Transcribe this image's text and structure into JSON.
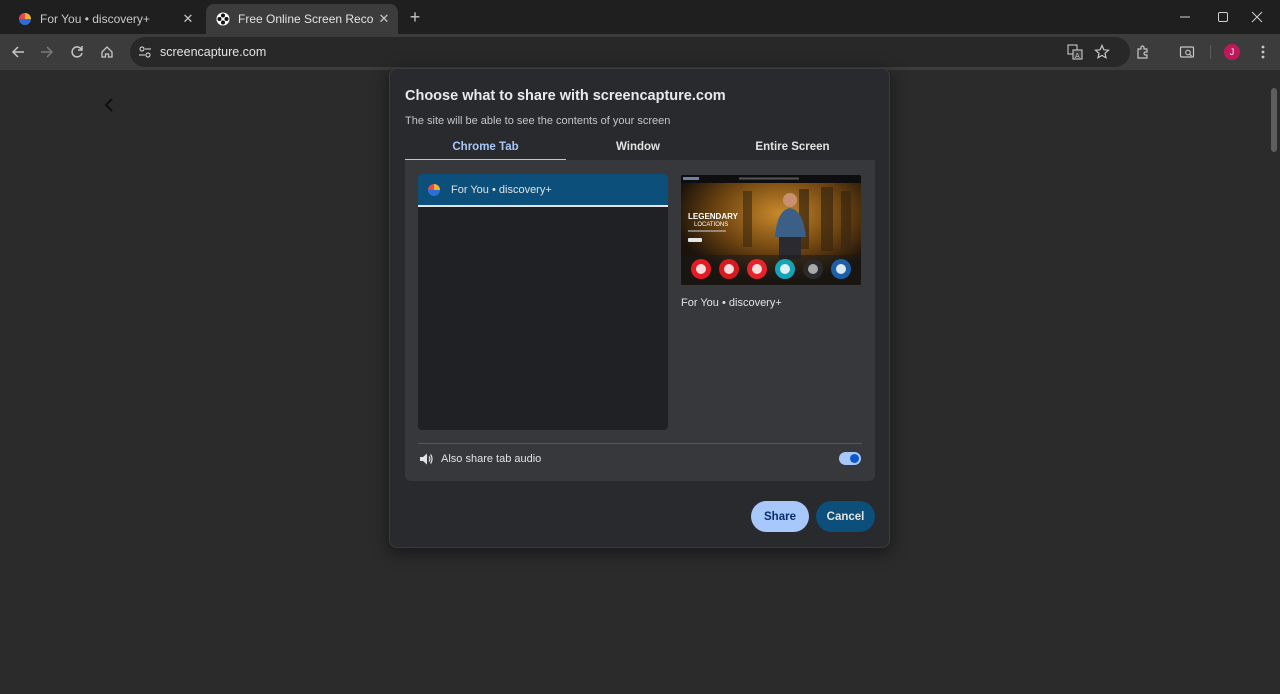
{
  "tabs": [
    {
      "title": "For You • discovery+",
      "icon": "discovery-favicon",
      "active": false
    },
    {
      "title": "Free Online Screen Recorder | C",
      "icon": "screencapture-favicon",
      "active": true
    }
  ],
  "address_bar": {
    "url": "screencapture.com"
  },
  "profile": {
    "initial": "J",
    "color": "#c2185b"
  },
  "dialog": {
    "title": "Choose what to share with screencapture.com",
    "subtitle": "The site will be able to see the contents of your screen",
    "tabs": [
      "Chrome Tab",
      "Window",
      "Entire Screen"
    ],
    "selected_tab": "Chrome Tab",
    "items": [
      {
        "label": "For You • discovery+",
        "selected": true
      }
    ],
    "preview_caption": "For You • discovery+",
    "preview": {
      "headline_line1": "LEGENDARY",
      "headline_line2": "LOCATIONS"
    },
    "audio": {
      "label": "Also share tab audio",
      "enabled": true
    },
    "share_label": "Share",
    "cancel_label": "Cancel"
  },
  "colors": {
    "accent": "#a8c7fa",
    "selected_bg": "#0b4f7a"
  }
}
